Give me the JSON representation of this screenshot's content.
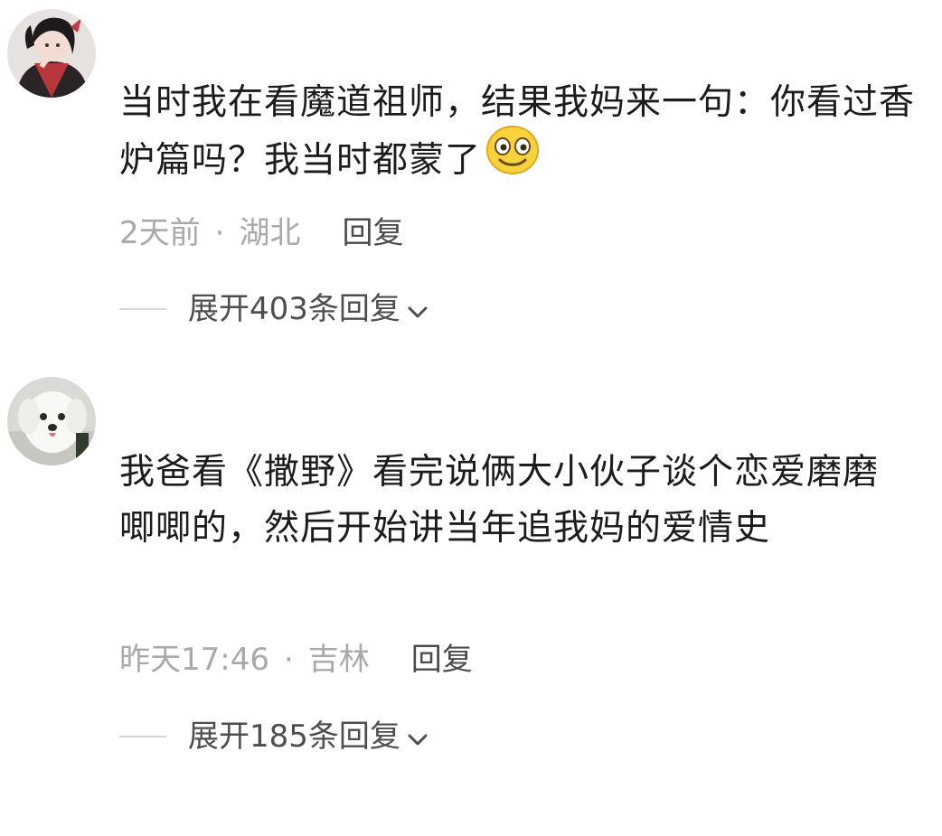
{
  "comments": [
    {
      "avatar_icon": "anime-character-avatar",
      "text": "当时我在看魔道祖师，结果我妈来一句：你看过香炉篇吗？我当时都蒙了",
      "emoji_icon": "smiling-face-emoji",
      "time": "2天前",
      "separator": "·",
      "location": "湖北",
      "reply_label": "回复",
      "expand_label": "展开403条回复"
    },
    {
      "avatar_icon": "white-dog-avatar",
      "text": "我爸看《撒野》看完说俩大小伙子谈个恋爱磨磨唧唧的，然后开始讲当年追我妈的爱情史",
      "time": "昨天17:46",
      "separator": "·",
      "location": "吉林",
      "reply_label": "回复",
      "expand_label": "展开185条回复"
    }
  ],
  "colors": {
    "text": "#1c1c1c",
    "meta": "#a9a9a9",
    "reply": "#4b4b4b",
    "emoji_face": "#f7d23c"
  }
}
